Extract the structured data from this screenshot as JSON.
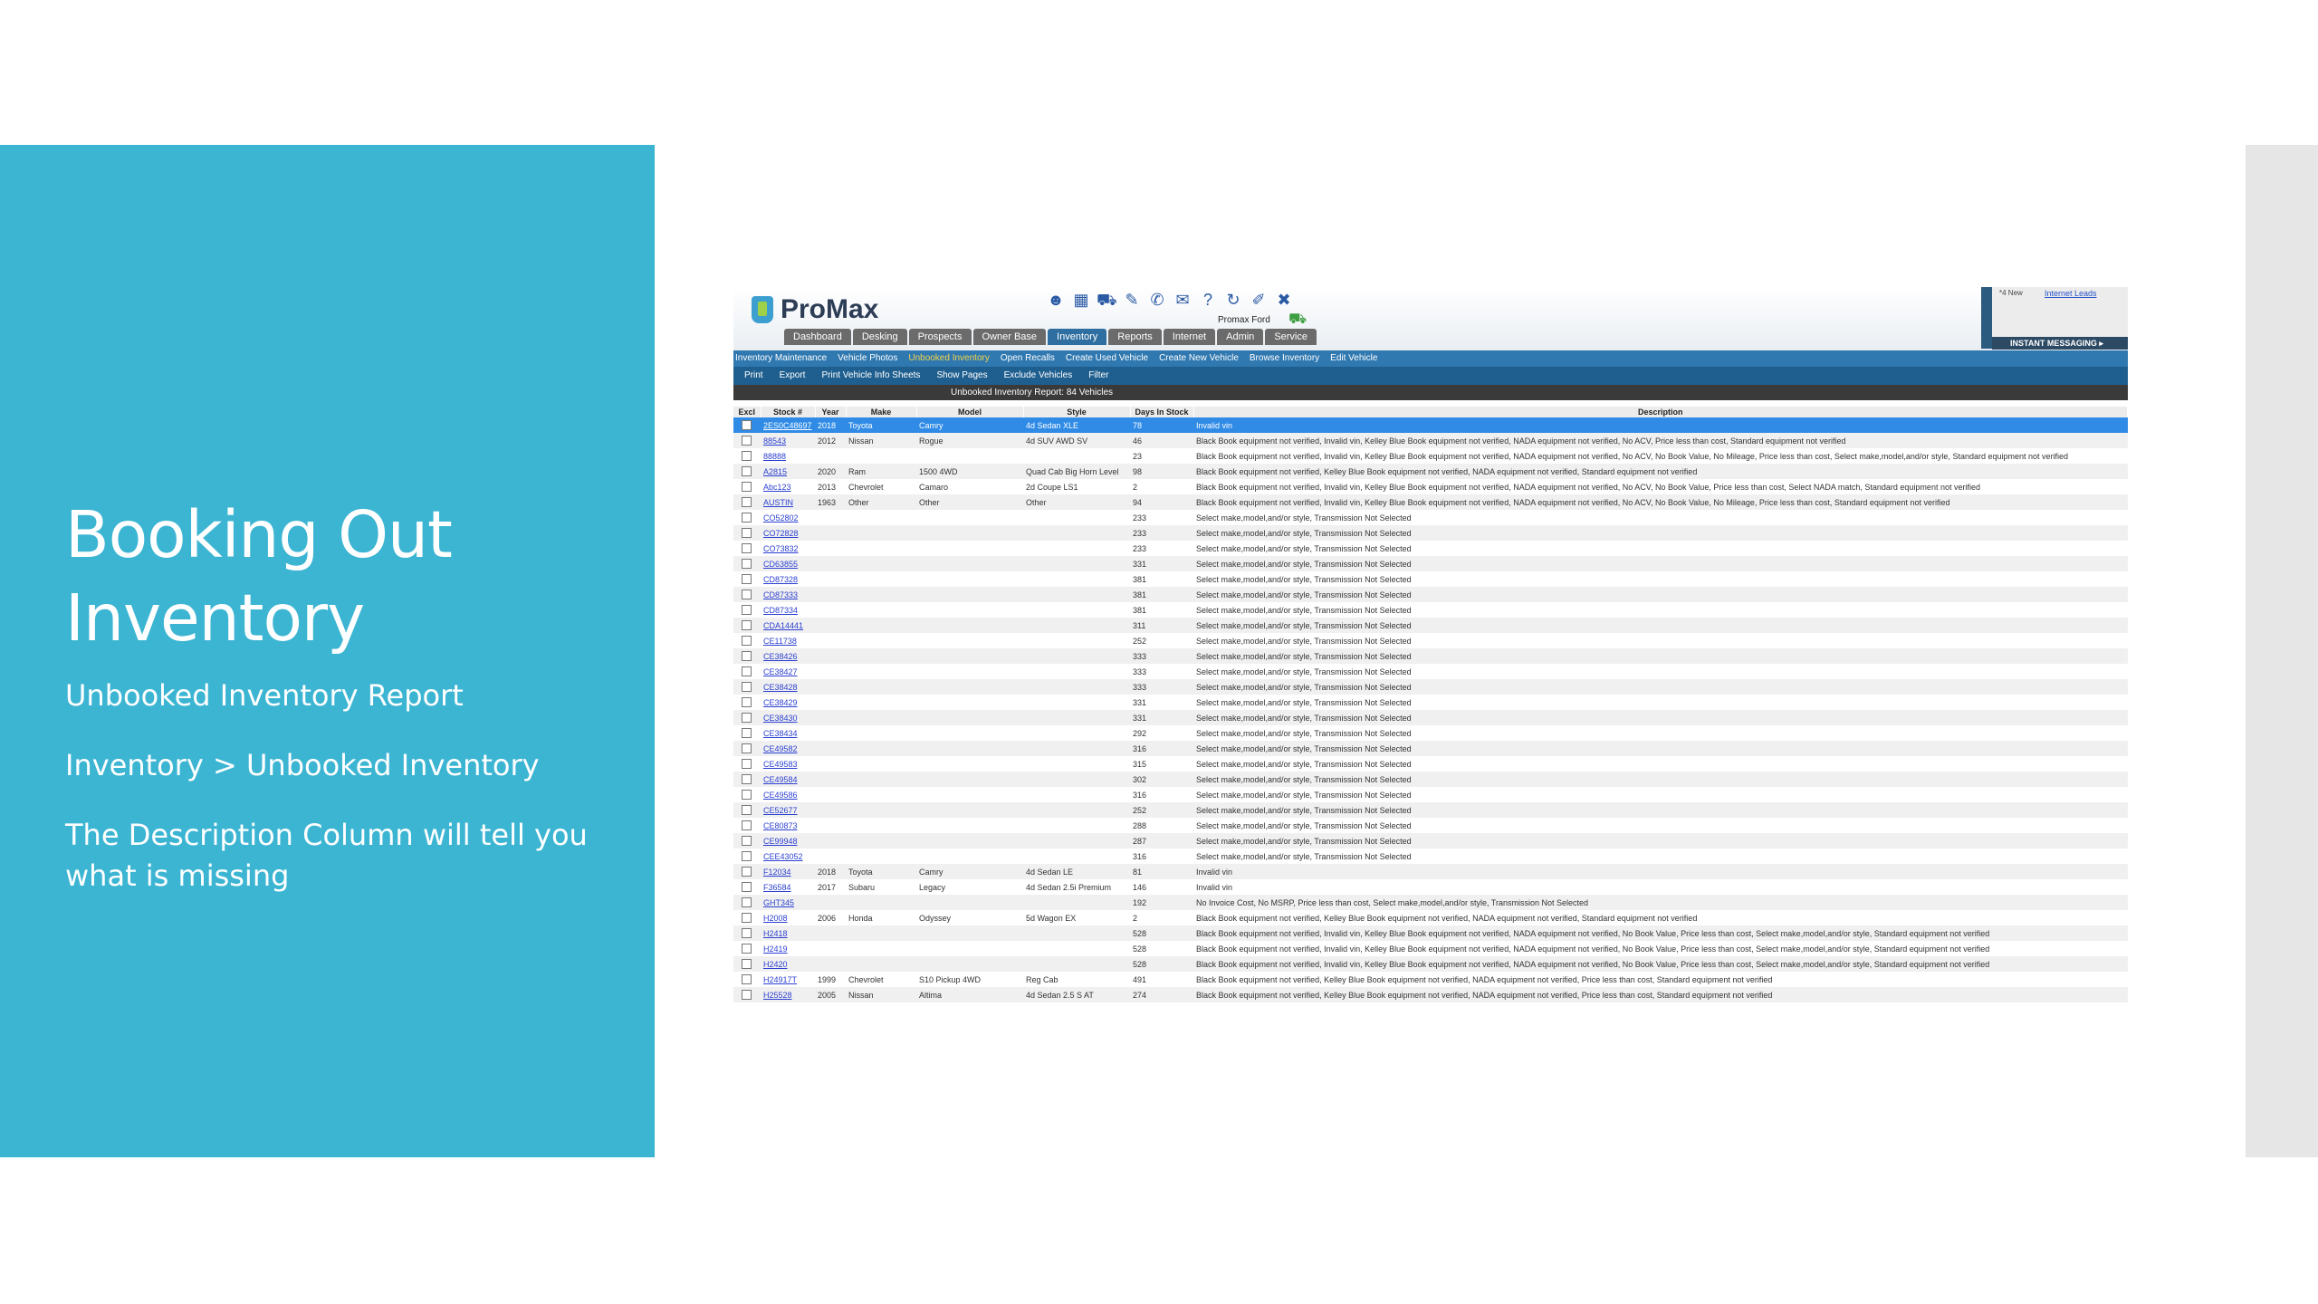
{
  "slide": {
    "title": "Booking Out Inventory",
    "lines": [
      "Unbooked Inventory Report",
      "Inventory > Unbooked Inventory",
      "The Description Column will tell you what is missing"
    ]
  },
  "app": {
    "logo": "ProMax",
    "dealer": "Promax Ford",
    "toolbar_icons": [
      "users-icon",
      "calendar-icon",
      "car-icon",
      "wrench-icon",
      "phone-icon",
      "mail-icon",
      "help-icon",
      "refresh-icon",
      "edit-icon",
      "close-icon"
    ],
    "tabs": [
      "Dashboard",
      "Desking",
      "Prospects",
      "Owner Base",
      "Inventory",
      "Reports",
      "Internet",
      "Admin",
      "Service"
    ],
    "active_tab": "Inventory",
    "side_panel": {
      "small_text": "*4 New",
      "link": "Internet Leads",
      "instant_messaging": "INSTANT MESSAGING"
    },
    "subnav": [
      "Inventory Maintenance",
      "Vehicle Photos",
      "Unbooked Inventory",
      "Open Recalls",
      "Create Used Vehicle",
      "Create New Vehicle",
      "Browse Inventory",
      "Edit Vehicle"
    ],
    "subnav_active": "Unbooked Inventory",
    "actions": [
      "Print",
      "Export",
      "Print Vehicle Info Sheets",
      "Show Pages",
      "Exclude Vehicles",
      "Filter"
    ],
    "report_title": "Unbooked Inventory Report: 84 Vehicles",
    "columns": [
      "Excl",
      "Stock #",
      "Year",
      "Make",
      "Model",
      "Style",
      "Days In Stock",
      "Description"
    ],
    "rows": [
      {
        "stock": "2ES0C48697",
        "year": "2018",
        "make": "Toyota",
        "model": "Camry",
        "style": "4d Sedan XLE",
        "days": "78",
        "desc": "Invalid vin",
        "selected": true
      },
      {
        "stock": "88543",
        "year": "2012",
        "make": "Nissan",
        "model": "Rogue",
        "style": "4d SUV AWD SV",
        "days": "46",
        "desc": "Black Book equipment not verified, Invalid vin, Kelley Blue Book equipment not verified, NADA equipment not verified, No ACV, Price less than cost, Standard equipment not verified"
      },
      {
        "stock": "88888",
        "year": "",
        "make": "",
        "model": "",
        "style": "",
        "days": "23",
        "desc": "Black Book equipment not verified, Invalid vin, Kelley Blue Book equipment not verified, NADA equipment not verified, No ACV, No Book Value, No Mileage, Price less than cost, Select make,model,and/or style, Standard equipment not verified"
      },
      {
        "stock": "A2815",
        "year": "2020",
        "make": "Ram",
        "model": "1500 4WD",
        "style": "Quad Cab Big Horn Level",
        "days": "98",
        "desc": "Black Book equipment not verified, Kelley Blue Book equipment not verified, NADA equipment not verified, Standard equipment not verified"
      },
      {
        "stock": "Abc123",
        "year": "2013",
        "make": "Chevrolet",
        "model": "Camaro",
        "style": "2d Coupe LS1",
        "days": "2",
        "desc": "Black Book equipment not verified, Invalid vin, Kelley Blue Book equipment not verified, NADA equipment not verified, No ACV, No Book Value, Price less than cost, Select NADA match, Standard equipment not verified"
      },
      {
        "stock": "AUSTIN",
        "year": "1963",
        "make": "Other",
        "model": "Other",
        "style": "Other",
        "days": "94",
        "desc": "Black Book equipment not verified, Invalid vin, Kelley Blue Book equipment not verified, NADA equipment not verified, No ACV, No Book Value, No Mileage, Price less than cost, Standard equipment not verified"
      },
      {
        "stock": "CO52802",
        "year": "",
        "make": "",
        "model": "",
        "style": "",
        "days": "233",
        "desc": "Select make,model,and/or style, Transmission Not Selected"
      },
      {
        "stock": "CO72828",
        "year": "",
        "make": "",
        "model": "",
        "style": "",
        "days": "233",
        "desc": "Select make,model,and/or style, Transmission Not Selected"
      },
      {
        "stock": "CO73832",
        "year": "",
        "make": "",
        "model": "",
        "style": "",
        "days": "233",
        "desc": "Select make,model,and/or style, Transmission Not Selected"
      },
      {
        "stock": "CD63855",
        "year": "",
        "make": "",
        "model": "",
        "style": "",
        "days": "331",
        "desc": "Select make,model,and/or style, Transmission Not Selected"
      },
      {
        "stock": "CD87328",
        "year": "",
        "make": "",
        "model": "",
        "style": "",
        "days": "381",
        "desc": "Select make,model,and/or style, Transmission Not Selected"
      },
      {
        "stock": "CD87333",
        "year": "",
        "make": "",
        "model": "",
        "style": "",
        "days": "381",
        "desc": "Select make,model,and/or style, Transmission Not Selected"
      },
      {
        "stock": "CD87334",
        "year": "",
        "make": "",
        "model": "",
        "style": "",
        "days": "381",
        "desc": "Select make,model,and/or style, Transmission Not Selected"
      },
      {
        "stock": "CDA14441",
        "year": "",
        "make": "",
        "model": "",
        "style": "",
        "days": "311",
        "desc": "Select make,model,and/or style, Transmission Not Selected"
      },
      {
        "stock": "CE11738",
        "year": "",
        "make": "",
        "model": "",
        "style": "",
        "days": "252",
        "desc": "Select make,model,and/or style, Transmission Not Selected"
      },
      {
        "stock": "CE38426",
        "year": "",
        "make": "",
        "model": "",
        "style": "",
        "days": "333",
        "desc": "Select make,model,and/or style, Transmission Not Selected"
      },
      {
        "stock": "CE38427",
        "year": "",
        "make": "",
        "model": "",
        "style": "",
        "days": "333",
        "desc": "Select make,model,and/or style, Transmission Not Selected"
      },
      {
        "stock": "CE38428",
        "year": "",
        "make": "",
        "model": "",
        "style": "",
        "days": "333",
        "desc": "Select make,model,and/or style, Transmission Not Selected"
      },
      {
        "stock": "CE38429",
        "year": "",
        "make": "",
        "model": "",
        "style": "",
        "days": "331",
        "desc": "Select make,model,and/or style, Transmission Not Selected"
      },
      {
        "stock": "CE38430",
        "year": "",
        "make": "",
        "model": "",
        "style": "",
        "days": "331",
        "desc": "Select make,model,and/or style, Transmission Not Selected"
      },
      {
        "stock": "CE38434",
        "year": "",
        "make": "",
        "model": "",
        "style": "",
        "days": "292",
        "desc": "Select make,model,and/or style, Transmission Not Selected"
      },
      {
        "stock": "CE49582",
        "year": "",
        "make": "",
        "model": "",
        "style": "",
        "days": "316",
        "desc": "Select make,model,and/or style, Transmission Not Selected"
      },
      {
        "stock": "CE49583",
        "year": "",
        "make": "",
        "model": "",
        "style": "",
        "days": "315",
        "desc": "Select make,model,and/or style, Transmission Not Selected"
      },
      {
        "stock": "CE49584",
        "year": "",
        "make": "",
        "model": "",
        "style": "",
        "days": "302",
        "desc": "Select make,model,and/or style, Transmission Not Selected"
      },
      {
        "stock": "CE49586",
        "year": "",
        "make": "",
        "model": "",
        "style": "",
        "days": "316",
        "desc": "Select make,model,and/or style, Transmission Not Selected"
      },
      {
        "stock": "CE52677",
        "year": "",
        "make": "",
        "model": "",
        "style": "",
        "days": "252",
        "desc": "Select make,model,and/or style, Transmission Not Selected"
      },
      {
        "stock": "CE80873",
        "year": "",
        "make": "",
        "model": "",
        "style": "",
        "days": "288",
        "desc": "Select make,model,and/or style, Transmission Not Selected"
      },
      {
        "stock": "CE99948",
        "year": "",
        "make": "",
        "model": "",
        "style": "",
        "days": "287",
        "desc": "Select make,model,and/or style, Transmission Not Selected"
      },
      {
        "stock": "CEE43052",
        "year": "",
        "make": "",
        "model": "",
        "style": "",
        "days": "316",
        "desc": "Select make,model,and/or style, Transmission Not Selected"
      },
      {
        "stock": "F12034",
        "year": "2018",
        "make": "Toyota",
        "model": "Camry",
        "style": "4d Sedan LE",
        "days": "81",
        "desc": "Invalid vin"
      },
      {
        "stock": "F36584",
        "year": "2017",
        "make": "Subaru",
        "model": "Legacy",
        "style": "4d Sedan 2.5i Premium",
        "days": "146",
        "desc": "Invalid vin"
      },
      {
        "stock": "GHT345",
        "year": "",
        "make": "",
        "model": "",
        "style": "",
        "days": "192",
        "desc": "No Invoice Cost, No MSRP, Price less than cost, Select make,model,and/or style, Transmission Not Selected"
      },
      {
        "stock": "H2008",
        "year": "2006",
        "make": "Honda",
        "model": "Odyssey",
        "style": "5d Wagon EX",
        "days": "2",
        "desc": "Black Book equipment not verified, Kelley Blue Book equipment not verified, NADA equipment not verified, Standard equipment not verified"
      },
      {
        "stock": "H2418",
        "year": "",
        "make": "",
        "model": "",
        "style": "",
        "days": "528",
        "desc": "Black Book equipment not verified, Invalid vin, Kelley Blue Book equipment not verified, NADA equipment not verified, No Book Value, Price less than cost, Select make,model,and/or style, Standard equipment not verified"
      },
      {
        "stock": "H2419",
        "year": "",
        "make": "",
        "model": "",
        "style": "",
        "days": "528",
        "desc": "Black Book equipment not verified, Invalid vin, Kelley Blue Book equipment not verified, NADA equipment not verified, No Book Value, Price less than cost, Select make,model,and/or style, Standard equipment not verified"
      },
      {
        "stock": "H2420",
        "year": "",
        "make": "",
        "model": "",
        "style": "",
        "days": "528",
        "desc": "Black Book equipment not verified, Invalid vin, Kelley Blue Book equipment not verified, NADA equipment not verified, No Book Value, Price less than cost, Select make,model,and/or style, Standard equipment not verified"
      },
      {
        "stock": "H24917T",
        "year": "1999",
        "make": "Chevrolet",
        "model": "S10 Pickup 4WD",
        "style": "Reg Cab",
        "days": "491",
        "desc": "Black Book equipment not verified, Kelley Blue Book equipment not verified, NADA equipment not verified, Price less than cost, Standard equipment not verified"
      },
      {
        "stock": "H25528",
        "year": "2005",
        "make": "Nissan",
        "model": "Altima",
        "style": "4d Sedan 2.5 S AT",
        "days": "274",
        "desc": "Black Book equipment not verified, Kelley Blue Book equipment not verified, NADA equipment not verified, Price less than cost, Standard equipment not verified"
      }
    ]
  }
}
